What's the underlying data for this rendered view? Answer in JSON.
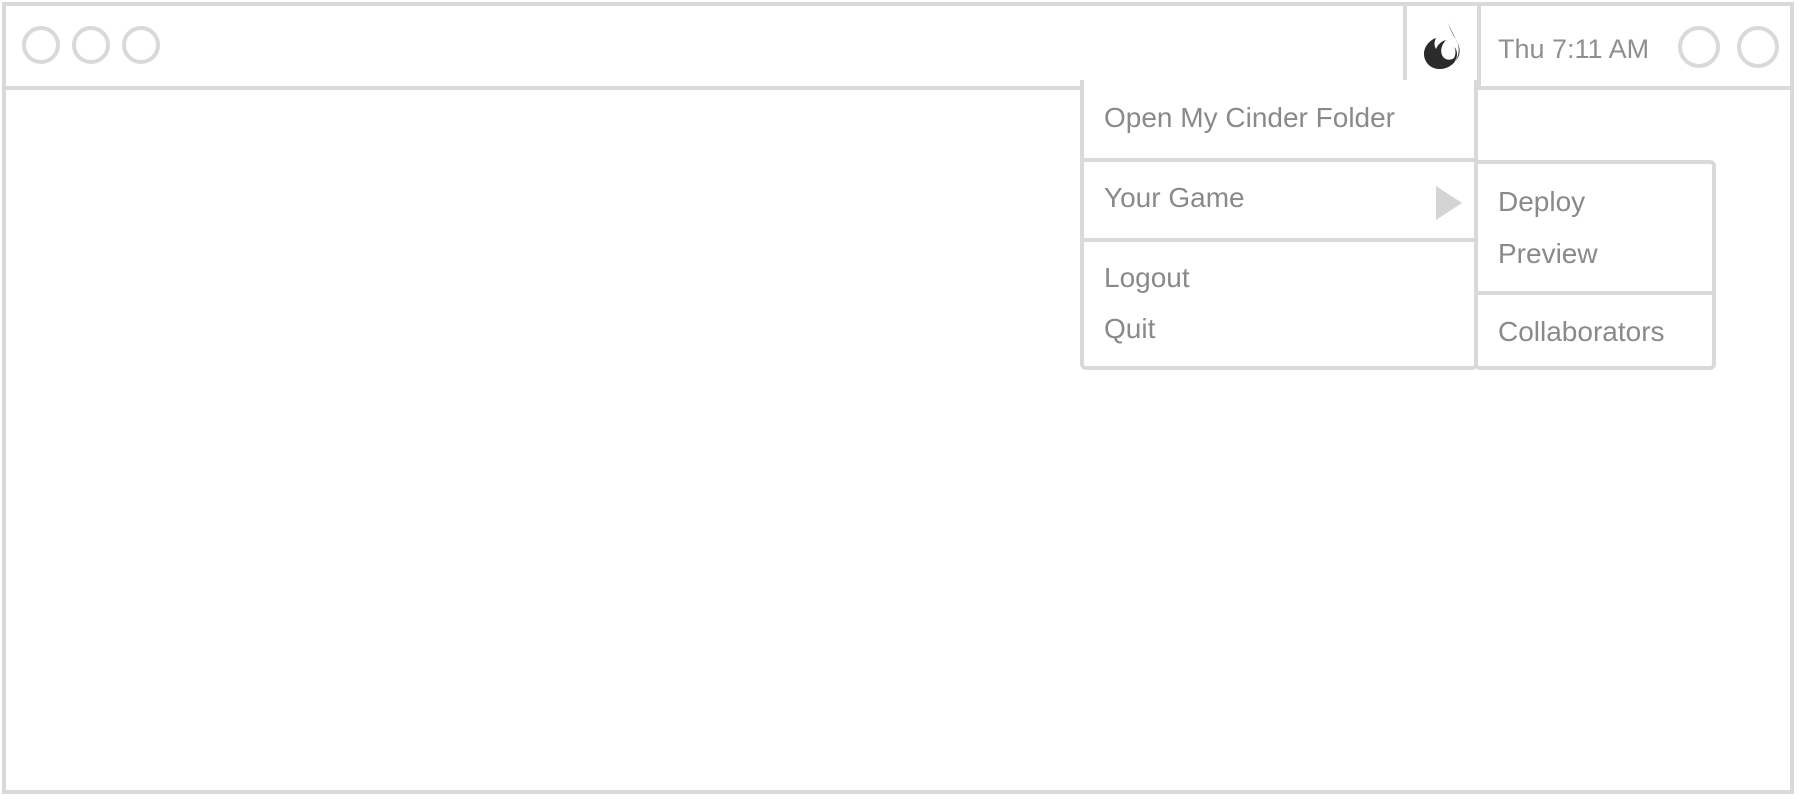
{
  "titlebar": {
    "traffic_lights": [
      "close",
      "minimize",
      "maximize"
    ],
    "status_icons": [
      "status-circle",
      "status-circle"
    ]
  },
  "menubar": {
    "app_icon": "cinder-flame-icon",
    "clock": "Thu 7:11 AM"
  },
  "menu": {
    "items": [
      {
        "label": "Open My Cinder Folder"
      },
      {
        "label": "Your Game",
        "submenu_icon": "triangle-right-icon"
      },
      {
        "label": "Logout"
      },
      {
        "label": "Quit"
      }
    ]
  },
  "submenu": {
    "items": [
      {
        "label": "Deploy"
      },
      {
        "label": "Preview"
      },
      {
        "label": "Collaborators"
      }
    ]
  },
  "colors": {
    "border": "#d9d9d9",
    "text": "#8a8a8a",
    "logo": "#2b2b2b"
  }
}
